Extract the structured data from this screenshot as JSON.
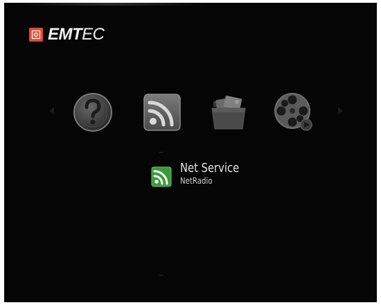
{
  "brand": {
    "name_bold": "EMT",
    "name_light": "EC",
    "accent": "#e24a33"
  },
  "menu": {
    "items": [
      {
        "id": "help",
        "icon": "question-mark-icon"
      },
      {
        "id": "net-service",
        "icon": "rss-feed-icon",
        "selected": true
      },
      {
        "id": "files",
        "icon": "folder-icon"
      },
      {
        "id": "movies",
        "icon": "film-reel-icon"
      }
    ],
    "selected": {
      "title": "Net Service",
      "subtitle": "NetRadio",
      "icon": "rss-feed-icon",
      "icon_color": "#3a9a3a"
    }
  }
}
